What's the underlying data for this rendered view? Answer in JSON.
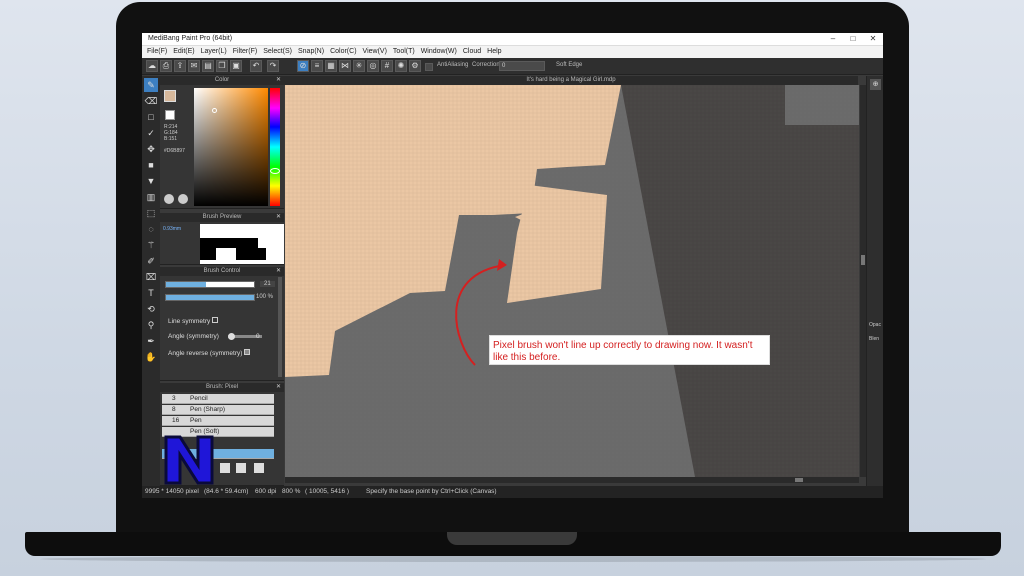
{
  "window": {
    "title": "MediBang Paint Pro (64bit)",
    "controls": [
      "–",
      "□",
      "✕"
    ]
  },
  "menu": [
    "File(F)",
    "Edit(E)",
    "Layer(L)",
    "Filter(F)",
    "Select(S)",
    "Snap(N)",
    "Color(C)",
    "View(V)",
    "Tool(T)",
    "Window(W)",
    "Cloud",
    "Help"
  ],
  "toolbar": {
    "antialiasing_label": "AntiAliasing",
    "correction_label": "Correction",
    "correction_value": "0",
    "soft_edge_label": "Soft Edge"
  },
  "color_panel": {
    "title": "Color",
    "rgb": [
      "R:214",
      "G:184",
      "B:151"
    ],
    "hex": "#D6B897",
    "fg_color": "#D6B89B"
  },
  "brush_preview": {
    "title": "Brush Preview",
    "size": "0.93mm"
  },
  "brush_control": {
    "title": "Brush Control",
    "size_value": "21",
    "opacity_value": "100 %",
    "size_fill": 0.7,
    "opacity_fill": 1.0,
    "line_symmetry": "Line symmetry",
    "angle_symmetry": "Angle (symmetry)",
    "angle_value": "0",
    "angle_reverse": "Angle reverse (symmetry)"
  },
  "brush_list": {
    "title": "Brush: Pixel",
    "items": [
      {
        "num": "3",
        "name": "Pencil"
      },
      {
        "num": "8",
        "name": "Pen (Sharp)"
      },
      {
        "num": "16",
        "name": "Pen"
      },
      {
        "num": "",
        "name": "Pen (Soft)"
      }
    ]
  },
  "canvas": {
    "tab_title": "It's hard being a Magical Girl.mdp"
  },
  "right_panel": {
    "labels": [
      "Opac",
      "Blen"
    ]
  },
  "status": {
    "size": "9995 * 14050 pixel",
    "cm": "(84.6 * 59.4cm)",
    "dpi": "600 dpi",
    "zoom": "800 %",
    "coords": "( 10005, 5416 )",
    "hint": "Specify the base point by Ctrl+Click (Canvas)"
  },
  "annotation": {
    "text": "Pixel brush won't line up correctly to drawing now. It wasn't like this before.",
    "color": "#D42020"
  },
  "colors": {
    "skin": "#EBC7A4",
    "canvas_gray": "#5E5E5E",
    "dark_gray": "#4A4746",
    "accent": "#3D7FC1"
  }
}
